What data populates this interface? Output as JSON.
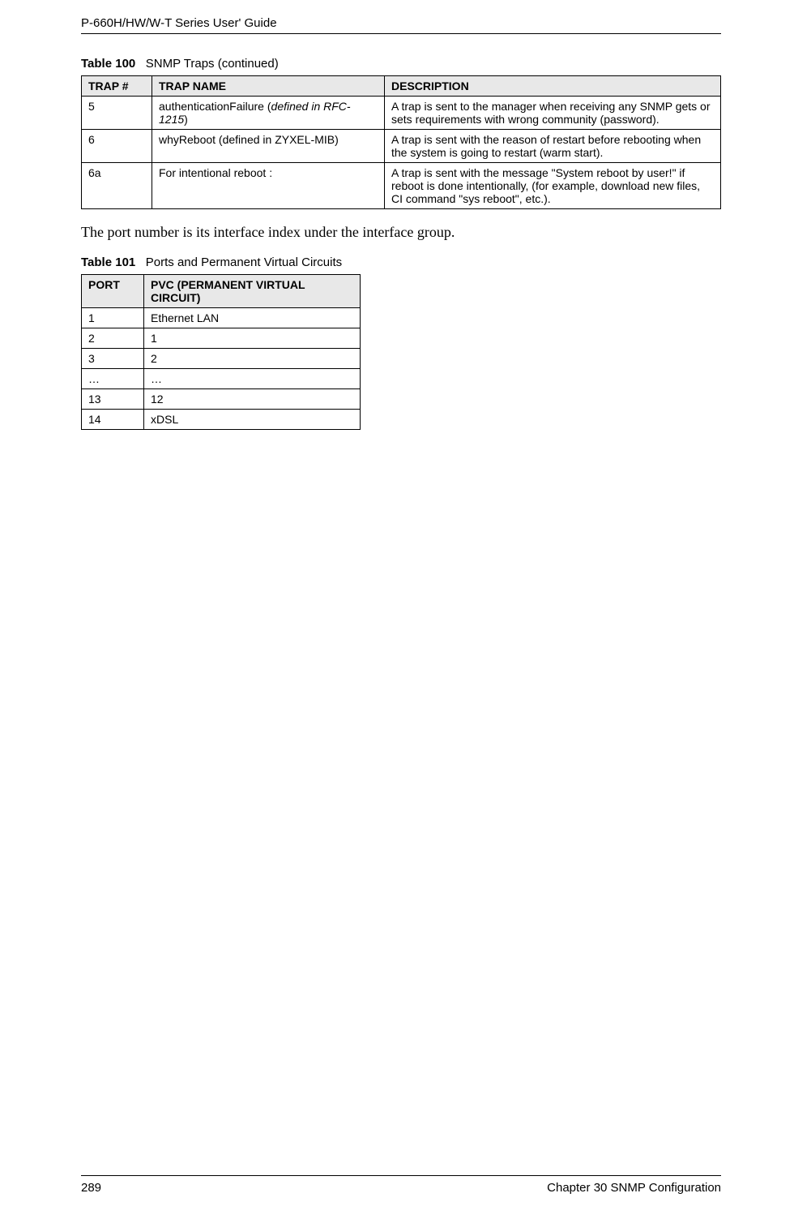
{
  "header": {
    "running_head": "P-660H/HW/W-T Series User' Guide"
  },
  "table100": {
    "caption_prefix": "Table 100",
    "caption_title": "SNMP Traps (continued)",
    "headers": {
      "c1": "TRAP #",
      "c2": "TRAP NAME",
      "c3": "DESCRIPTION"
    },
    "rows": [
      {
        "c1": "5",
        "c2_pre": "authenticationFailure (",
        "c2_italic": "defined in RFC-1215",
        "c2_post": ")",
        "c3": "A trap is sent to the manager when receiving any SNMP gets or sets requirements with wrong community (password)."
      },
      {
        "c1": "6",
        "c2": "whyReboot (defined in ZYXEL-MIB)",
        "c3": "A trap is sent with the reason of restart before rebooting when the system is going to restart (warm start)."
      },
      {
        "c1": "6a",
        "c2": "For intentional reboot :",
        "c3": "A trap is sent with the message \"System reboot by user!\" if reboot is done intentionally, (for example, download new files, CI command \"sys reboot\", etc.)."
      }
    ]
  },
  "body_text": "The port number is its interface index under the interface group.",
  "table101": {
    "caption_prefix": "Table 101",
    "caption_title": "Ports and Permanent Virtual Circuits",
    "headers": {
      "c1": "PORT",
      "c2": "PVC (PERMANENT VIRTUAL CIRCUIT)"
    },
    "rows": [
      {
        "c1": "1",
        "c2": "Ethernet LAN"
      },
      {
        "c1": "2",
        "c2": "1"
      },
      {
        "c1": "3",
        "c2": "2"
      },
      {
        "c1": "…",
        "c2": "…"
      },
      {
        "c1": "13",
        "c2": "12"
      },
      {
        "c1": "14",
        "c2": "xDSL"
      }
    ]
  },
  "footer": {
    "page_number": "289",
    "chapter": "Chapter 30 SNMP Configuration"
  }
}
